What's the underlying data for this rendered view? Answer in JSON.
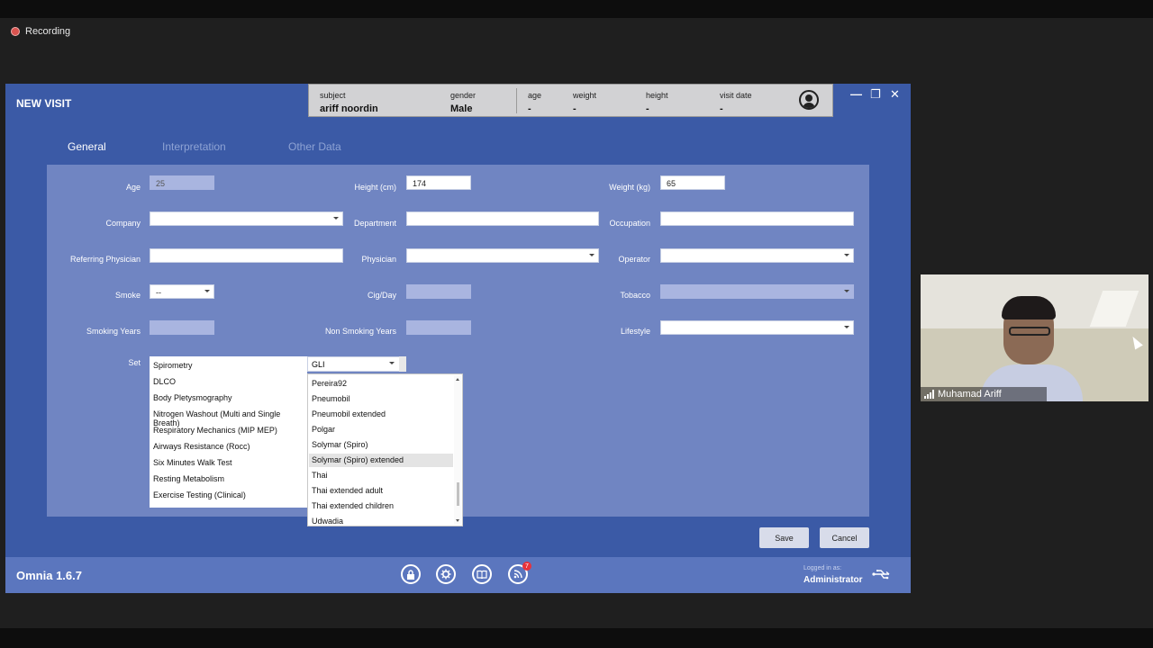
{
  "recording": {
    "label": "Recording"
  },
  "window": {
    "title": "NEW VISIT",
    "controls": {
      "minimize": "—",
      "restore": "❐",
      "close": "✕"
    }
  },
  "subject_bar": {
    "subject_label": "subject",
    "subject_value": "ariff noordin",
    "gender_label": "gender",
    "gender_value": "Male",
    "age_label": "age",
    "age_value": "-",
    "weight_label": "weight",
    "weight_value": "-",
    "height_label": "height",
    "height_value": "-",
    "visit_date_label": "visit date",
    "visit_date_value": "-"
  },
  "tabs": [
    "General",
    "Interpretation",
    "Other Data"
  ],
  "form": {
    "age_label": "Age",
    "age_value": "25",
    "height_label": "Height (cm)",
    "height_value": "174",
    "weight_label": "Weight (kg)",
    "weight_value": "65",
    "company_label": "Company",
    "department_label": "Department",
    "occupation_label": "Occupation",
    "referring_label": "Referring Physician",
    "physician_label": "Physician",
    "operator_label": "Operator",
    "smoke_label": "Smoke",
    "smoke_value": "--",
    "cig_label": "Cig/Day",
    "tobacco_label": "Tobacco",
    "smoking_years_label": "Smoking Years",
    "non_smoking_years_label": "Non Smoking Years",
    "lifestyle_label": "Lifestyle",
    "set_label": "Set"
  },
  "set_list": [
    "Spirometry",
    "DLCO",
    "Body Pletysmography",
    "Nitrogen Washout (Multi and Single Breath)",
    "Respiratory Mechanics (MIP MEP)",
    "Airways Resistance (Rocc)",
    "Six Minutes Walk Test",
    "Resting Metabolism",
    "Exercise Testing (Clinical)"
  ],
  "reference_select": {
    "value": "GLI"
  },
  "reference_options": [
    "Pereira92",
    "Pneumobil",
    "Pneumobil extended",
    "Polgar",
    "Solymar (Spiro)",
    "Solymar (Spiro) extended",
    "Thai",
    "Thai extended adult",
    "Thai extended children",
    "Udwadia"
  ],
  "highlighted_option": "Solymar (Spiro) extended",
  "buttons": {
    "save": "Save",
    "cancel": "Cancel"
  },
  "footer": {
    "brand": "Omnia 1.6.7",
    "logged_in_label": "Logged in as:",
    "user": "Administrator",
    "notification_count": "7"
  },
  "video": {
    "participant": "Muhamad Ariff"
  },
  "colors": {
    "app_bg": "#3b5aa6",
    "panel_bg": "#7085c2",
    "footer_bg": "#5b76be",
    "badge": "#e8323b"
  }
}
